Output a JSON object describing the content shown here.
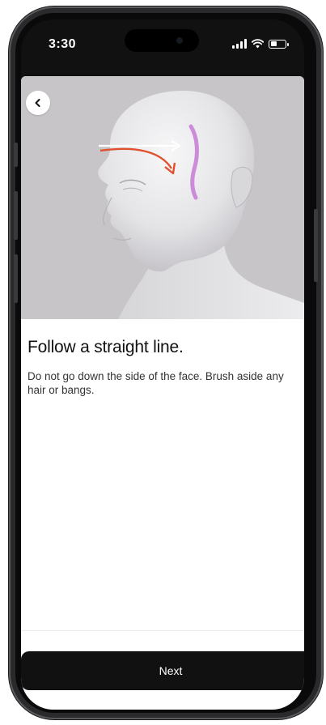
{
  "status_bar": {
    "time": "3:30",
    "battery_level": 0.45
  },
  "screen": {
    "back_icon": "chevron-left-icon",
    "illustration": "head-profile-brush-direction",
    "title": "Follow a straight line.",
    "description": "Do not go down the side of the face. Brush aside any hair or bangs.",
    "next_label": "Next"
  },
  "colors": {
    "arrow_straight": "#ffffff",
    "arrow_curved": "#e0502e",
    "hairline_accent": "#c77ad6",
    "button_bg": "#111111"
  }
}
